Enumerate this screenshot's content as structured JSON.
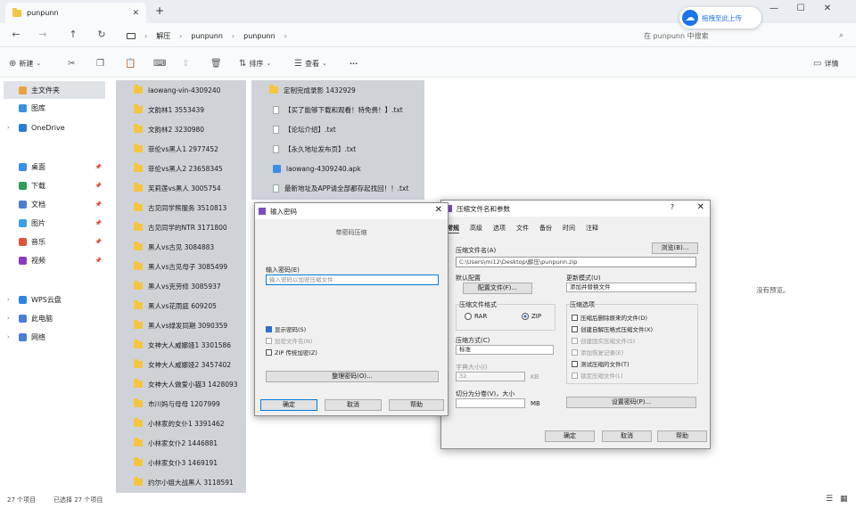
{
  "window": {
    "tab_title": "punpunn",
    "new_tab": "+",
    "close_tab": "✕",
    "controls": {
      "min": "—",
      "max": "☐",
      "close": "✕"
    }
  },
  "nav": {
    "back": "←",
    "forward": "→",
    "up": "↑",
    "refresh": "↻",
    "breadcrumb": [
      "解压",
      "punpunn",
      "punpunn"
    ],
    "search_placeholder": "在 punpunn 中搜索"
  },
  "cloud_button": {
    "label": "拖拽至此上传"
  },
  "toolbar": {
    "new": "新建",
    "sort": "排序",
    "view": "查看",
    "more": "···",
    "details": "详情"
  },
  "sidebar": {
    "items": [
      {
        "label": "主文件夹",
        "selected": true,
        "color": "#e8a33d"
      },
      {
        "label": "图库",
        "color": "#3a8ee6"
      },
      {
        "label": "OneDrive",
        "color": "#2b7cd3",
        "chevron": true
      },
      {
        "label": "桌面",
        "color": "#3a8ee6",
        "pinned": true
      },
      {
        "label": "下载",
        "color": "#2e9d55",
        "pinned": true
      },
      {
        "label": "文档",
        "color": "#4a7fd0",
        "pinned": true
      },
      {
        "label": "图片",
        "color": "#3aa0e6",
        "pinned": true
      },
      {
        "label": "音乐",
        "color": "#e0523a",
        "pinned": true
      },
      {
        "label": "视频",
        "color": "#8a3ac2",
        "pinned": true
      },
      {
        "label": "WPS云盘",
        "color": "#2f82e8",
        "chevron": true
      },
      {
        "label": "此电脑",
        "color": "#4a7fd0",
        "chevron": true
      },
      {
        "label": "网络",
        "color": "#4a7fd0",
        "chevron": true
      }
    ]
  },
  "files_col1": [
    "laowang-vin-4309240",
    "文韵林1 3553439",
    "文韵林2 3230980",
    "菲伦vs黑人1 2977452",
    "菲伦vs黑人2 23658345",
    "芙莉莲vs黑人 3005754",
    "古见同学熊服务 3510813",
    "古见同学的NTR 3171800",
    "黑人vs古见 3084883",
    "黑人vs古见母子 3085499",
    "黑人vs克劳修 3085937",
    "黑人vs花雨庭 609205",
    "黑人vs绿发同期 3090359",
    "女神大人威娜娅1 3301586",
    "女神大人威娜娅2 3457402",
    "女神大人做爱小猫3 1428093",
    "市川妈与母母 1207999",
    "小林家的女仆1 3391462",
    "小林家女仆2 1446881",
    "小林家女仆3 1469191",
    "约尔小姐大战黑人 3118591"
  ],
  "files_col2": [
    {
      "name": "定制完成录影 1432929",
      "type": "folder"
    },
    {
      "name": "【买了能够下载和观看！特免费！】.txt",
      "type": "txt"
    },
    {
      "name": "【论坛介绍】.txt",
      "type": "txt"
    },
    {
      "name": "【永久地址发布页】.txt",
      "type": "txt"
    },
    {
      "name": "laowang-4309240.apk",
      "type": "apk"
    },
    {
      "name": "最新地址及APP请全部都存起找回！！.txt",
      "type": "txt"
    }
  ],
  "empty_text": "没有预览。",
  "status": {
    "count": "27 个项目",
    "selected": "已选择 27 个项目"
  },
  "pwd_dialog": {
    "title": "输入密码",
    "subtitle": "带密码压缩",
    "enter_label": "输入密码(E)",
    "input_value": "输入密码以加密压缩文件",
    "show_pwd": "显示密码(S)",
    "encrypt_names": "加密文件名(N)",
    "zip_legacy": "ZIP 传统加密(Z)",
    "organize": "整理密码(O)...",
    "ok": "确定",
    "cancel": "取消",
    "help": "帮助"
  },
  "arc_dialog": {
    "title": "压缩文件名和参数",
    "help_q": "?",
    "close": "✕",
    "tabs": [
      "常规",
      "高级",
      "选项",
      "文件",
      "备份",
      "时间",
      "注释"
    ],
    "archive_name_label": "压缩文件名(A)",
    "browse": "浏览(B)...",
    "archive_path": "C:\\Users\\mi12\\Desktop\\解压\\punpunn.zip",
    "default_label": "默认配置",
    "profiles": "配置文件(F)...",
    "update_label": "更新模式(U)",
    "update_value": "添加并替换文件",
    "format_label": "压缩文件格式",
    "rar": "RAR",
    "zip": "ZIP",
    "method_label": "压缩方式(C)",
    "method_value": "标准",
    "dict_label": "字典大小(I)",
    "dict_value": "32",
    "dict_unit": "KB",
    "split_label": "切分为分卷(V)，大小",
    "split_unit": "MB",
    "options_label": "压缩选项",
    "options": [
      {
        "label": "压缩后删除原来的文件(D)",
        "checked": false,
        "disabled": false
      },
      {
        "label": "创建自解压格式压缩文件(X)",
        "checked": false,
        "disabled": false
      },
      {
        "label": "创建固实压缩文件(S)",
        "checked": false,
        "disabled": true
      },
      {
        "label": "添加恢复记录(E)",
        "checked": false,
        "disabled": true
      },
      {
        "label": "测试压缩的文件(T)",
        "checked": false,
        "disabled": false
      },
      {
        "label": "锁定压缩文件(L)",
        "checked": false,
        "disabled": true
      }
    ],
    "set_password": "设置密码(P)...",
    "ok": "确定",
    "cancel": "取消",
    "help": "帮助"
  }
}
